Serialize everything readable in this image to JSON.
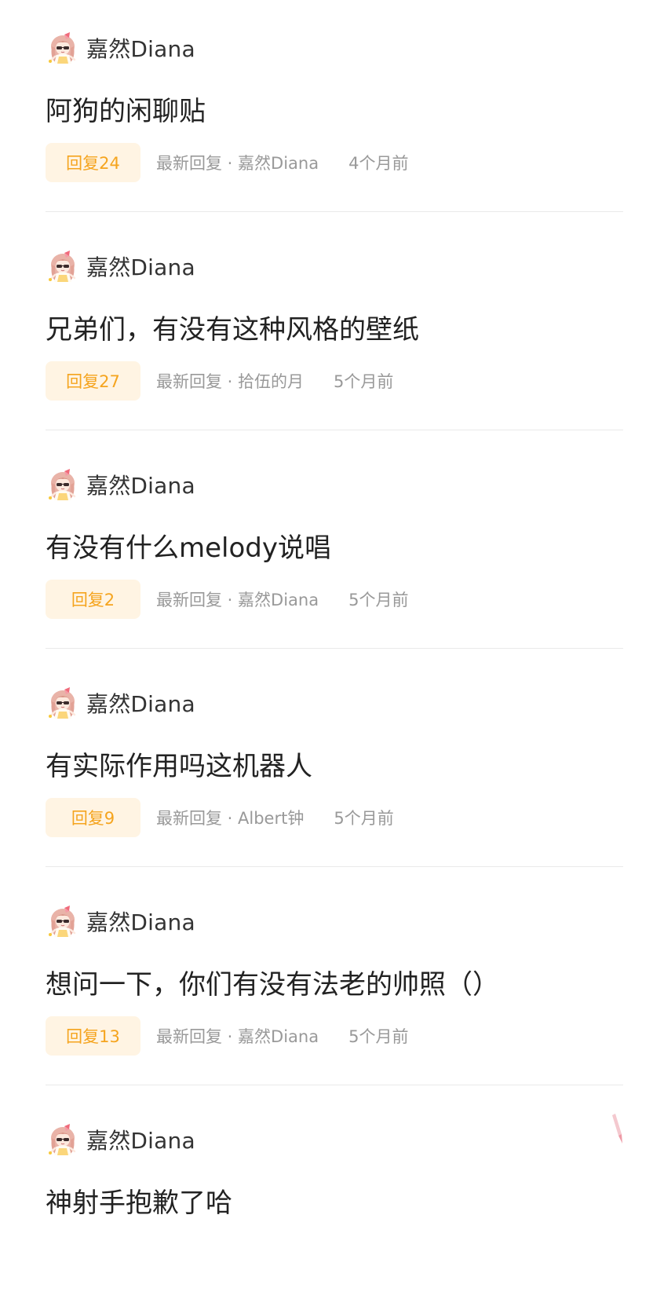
{
  "posts": [
    {
      "author": "嘉然Diana",
      "title": "阿狗的闲聊贴",
      "reply_label": "回复24",
      "latest_reply": "最新回复 · 嘉然Diana",
      "time_ago": "4个月前"
    },
    {
      "author": "嘉然Diana",
      "title": "兄弟们，有没有这种风格的壁纸",
      "reply_label": "回复27",
      "latest_reply": "最新回复 · 拾伍的月",
      "time_ago": "5个月前"
    },
    {
      "author": "嘉然Diana",
      "title": "有没有什么melody说唱",
      "reply_label": "回复2",
      "latest_reply": "最新回复 · 嘉然Diana",
      "time_ago": "5个月前"
    },
    {
      "author": "嘉然Diana",
      "title": "有实际作用吗这机器人",
      "reply_label": "回复9",
      "latest_reply": "最新回复 · Albert钟",
      "time_ago": "5个月前"
    },
    {
      "author": "嘉然Diana",
      "title": "想问一下，你们有没有法老的帅照（）",
      "reply_label": "回复13",
      "latest_reply": "最新回复 · 嘉然Diana",
      "time_ago": "5个月前"
    },
    {
      "author": "嘉然Diana",
      "title": "神射手抱歉了哈",
      "reply_label": "",
      "latest_reply": "",
      "time_ago": ""
    }
  ],
  "colors": {
    "badge_bg": "#fff4e3",
    "badge_text": "#f5a41e",
    "meta_text": "#999999",
    "author_text": "#333333",
    "divider": "#e9e9e9"
  },
  "icons": {
    "avatar": "anime-girl-avatar",
    "corner_decoration": "pink-ribbon-icon"
  }
}
